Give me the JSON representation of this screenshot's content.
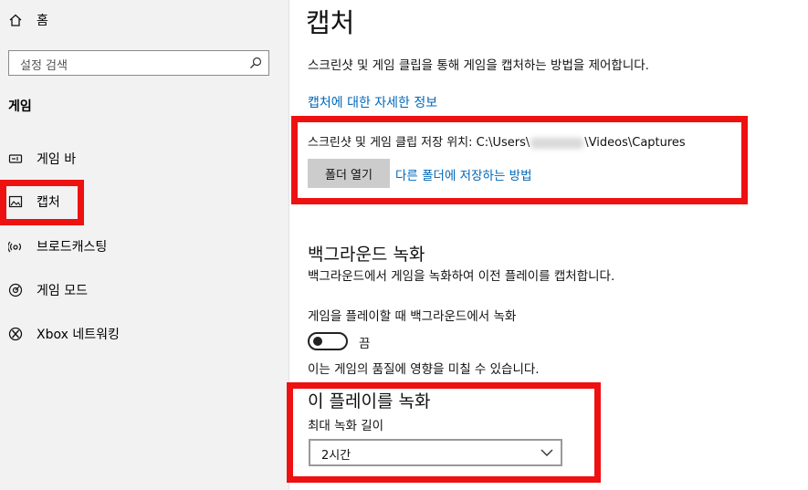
{
  "sidebar": {
    "home_label": "홈",
    "search_placeholder": "설정 검색",
    "section_title": "게임",
    "items": [
      {
        "label": "게임 바",
        "icon": "game-bar-icon"
      },
      {
        "label": "캡처",
        "icon": "capture-icon"
      },
      {
        "label": "브로드캐스팅",
        "icon": "broadcast-icon"
      },
      {
        "label": "게임 모드",
        "icon": "game-mode-icon"
      },
      {
        "label": "Xbox 네트워킹",
        "icon": "xbox-icon"
      }
    ]
  },
  "main": {
    "title": "캡처",
    "description": "스크린샷 및 게임 클립을 통해 게임을 캡처하는 방법을 제어합니다.",
    "info_link": "캡처에 대한 자세한 정보",
    "save_location": {
      "label_prefix": "스크린샷 및 게임 클립 저장 위치: C:\\Users\\",
      "label_suffix": "\\Videos\\Captures",
      "open_folder_button": "폴더 열기",
      "other_folder_link": "다른 폴더에 저장하는 방법"
    },
    "background_recording": {
      "heading": "백그라운드 녹화",
      "description": "백그라운드에서 게임을 녹화하여 이전 플레이를 캡처합니다.",
      "toggle_label": "게임을 플레이할 때 백그라운드에서 녹화",
      "toggle_state": "끔",
      "toggle_on": false,
      "quality_note": "이는 게임의 품질에 영향을 미칠 수 있습니다."
    },
    "record_this": {
      "heading": "이 플레이를 녹화",
      "max_length_label": "최대 녹화 길이",
      "max_length_value": "2시간"
    }
  },
  "colors": {
    "accent_link": "#0067b8",
    "highlight": "#ee1111",
    "sidebar_bg": "#f2f2f2"
  }
}
